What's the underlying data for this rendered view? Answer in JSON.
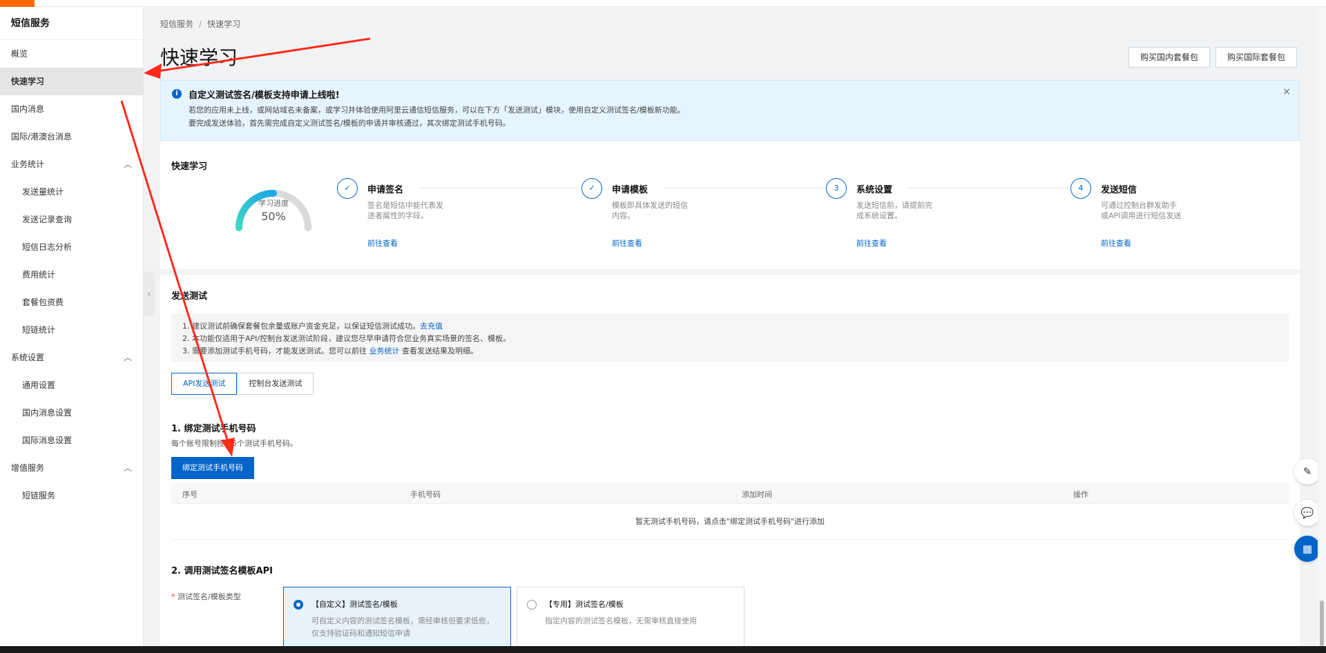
{
  "sidebar": {
    "title": "短信服务",
    "items": [
      {
        "label": "概览"
      },
      {
        "label": "快速学习"
      },
      {
        "label": "国内消息"
      },
      {
        "label": "国际/港澳台消息"
      },
      {
        "label": "业务统计",
        "chevron": "^"
      },
      {
        "label": "发送量统计"
      },
      {
        "label": "发送记录查询"
      },
      {
        "label": "短信日志分析"
      },
      {
        "label": "费用统计"
      },
      {
        "label": "套餐包资费"
      },
      {
        "label": "短链统计"
      },
      {
        "label": "系统设置",
        "chevron": "^"
      },
      {
        "label": "通用设置"
      },
      {
        "label": "国内消息设置"
      },
      {
        "label": "国际消息设置"
      },
      {
        "label": "增值服务",
        "chevron": "^"
      },
      {
        "label": "短链服务"
      }
    ]
  },
  "breadcrumb": {
    "root": "短信服务",
    "sep": "/",
    "current": "快速学习"
  },
  "page_title": "快速学习",
  "header_buttons": {
    "domestic": "购买国内套餐包",
    "international": "购买国际套餐包"
  },
  "notice": {
    "title": "自定义测试签名/模板支持申请上线啦!",
    "line1": "若您的应用未上线，或网站域名未备案，或学习并体验使用阿里云通信短信服务，可以在下方「发送测试」模块，使用自定义测试签名/模板新功能。",
    "line2": "要完成发送体验，首先需完成自定义测试签名/模板的申请并审核通过，其次绑定测试手机号码。",
    "close": "×"
  },
  "quick_learn": {
    "title": "快速学习",
    "progress_label": "学习进度",
    "progress_value": "50%",
    "progress_fraction": 0.5,
    "steps": [
      {
        "marker": "✓",
        "title": "申请签名",
        "desc": "签名是短信中能代表发送者属性的字段。",
        "link": "前往查看"
      },
      {
        "marker": "✓",
        "title": "申请模板",
        "desc": "模板即具体发送的短信内容。",
        "link": "前往查看"
      },
      {
        "marker": "3",
        "title": "系统设置",
        "desc": "发送短信前，请提前完成系统设置。",
        "link": "前往查看"
      },
      {
        "marker": "4",
        "title": "发送短信",
        "desc": "可通过控制台群发助手或API调用进行短信发送",
        "link": "前往查看"
      }
    ]
  },
  "send_test": {
    "title": "发送测试",
    "tip1": "1. 建议测试前确保套餐包余量或账户资金充足，以保证短信测试成功。",
    "tip1_link": "去充值",
    "tip2": "2. 本功能仅适用于API/控制台发送测试阶段，建议您尽早申请符合您业务真实场景的签名、模板。",
    "tip3_prefix": "3. 需要添加测试手机号码，才能发送测试。您可以前往",
    "tip3_link": "业务统计",
    "tip3_suffix": "查看发送结果及明细。",
    "tabs": [
      "API发送测试",
      "控制台发送测试"
    ],
    "bind": {
      "title": "1. 绑定测试手机号码",
      "desc": "每个账号限制授权5个测试手机号码。",
      "button": "绑定测试手机号码",
      "columns": [
        "序号",
        "手机号码",
        "添加时间",
        "操作"
      ],
      "empty": "暂无测试手机号码，请点击\"绑定测试手机号码\"进行添加"
    },
    "api": {
      "title": "2. 调用测试签名模板API",
      "field_label": "测试签名/模板类型",
      "required_mark": "*",
      "options": [
        {
          "title": "【自定义】测试签名/模板",
          "desc": "可自定义内容的测试签名模板，需经审核但要求低些，仅支持验证码和通知短信申请",
          "selected": true
        },
        {
          "title": "【专用】测试签名/模板",
          "desc": "指定内容的测试签名模板，无需审核直接使用",
          "selected": false
        }
      ]
    }
  },
  "floating": {
    "edit": "✎",
    "chat": "💬",
    "apps": "▦"
  },
  "colors": {
    "primary": "#0064c8",
    "notice_bg": "#e6f4ff",
    "annotation": "#ff2a1a",
    "brand": "#ff6a00"
  }
}
